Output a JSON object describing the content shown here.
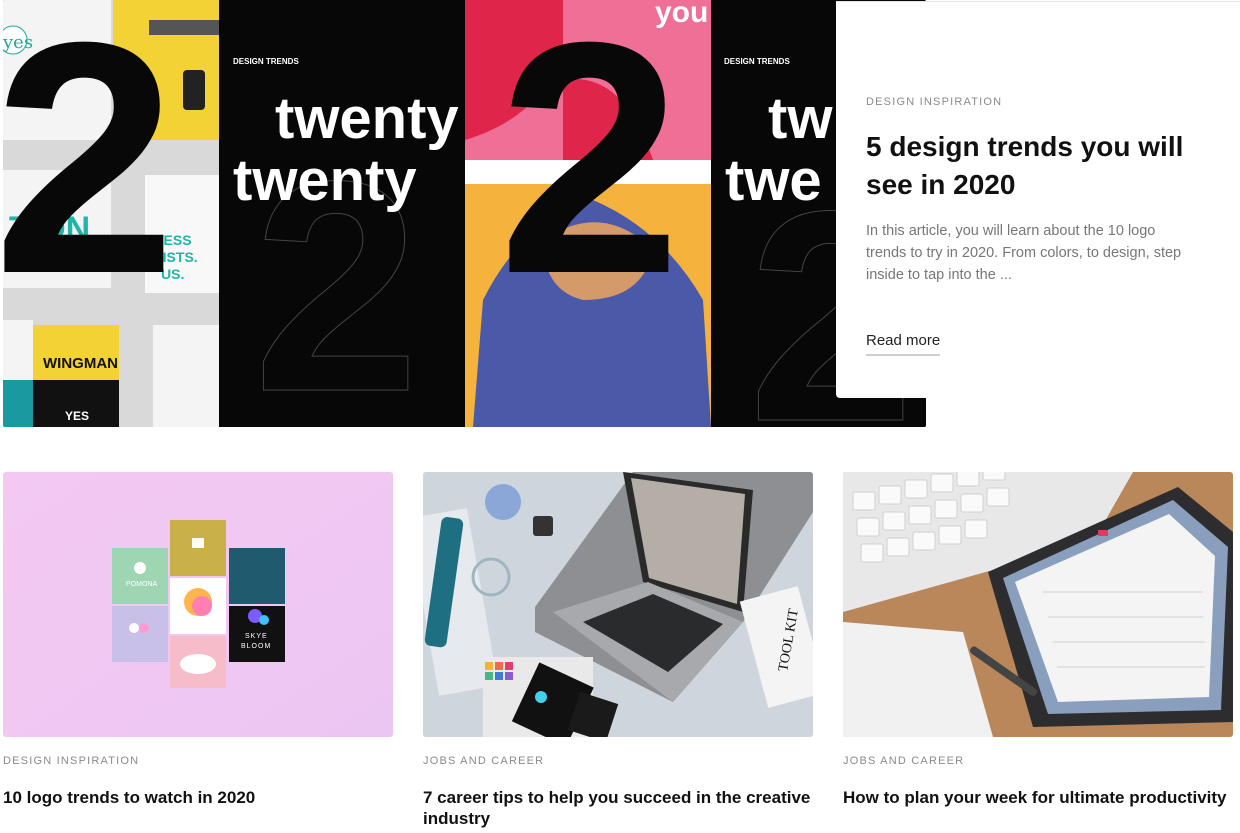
{
  "featured": {
    "image_text": {
      "numeral": "2",
      "trend_label": "DESIGN TRENDS",
      "word1": "twenty",
      "word2": "twenty",
      "top_text": "you",
      "side_word1": "tw",
      "side_word2": "twe",
      "book_yes": "yes",
      "book_wingman": "WINGMAN",
      "book_yes2": "YES",
      "book_line": "LESS MISTS. US."
    },
    "category": "DESIGN INSPIRATION",
    "title": "5 design trends you will see in 2020",
    "description": "In this article, you will learn about the 10 logo trends to try in 2020. From colors, to design, step inside to tap into the ...",
    "read_more": "Read more"
  },
  "articles": [
    {
      "category": "DESIGN INSPIRATION",
      "title": "10 logo trends to watch in 2020",
      "image_text": {
        "pomona": "POMONA",
        "skye": "SKYE",
        "bloom": "BLOOM"
      }
    },
    {
      "category": "JOBS AND CAREER",
      "title": "7 career tips to help you succeed in the creative industry",
      "image_text": {
        "toolkit": "TOOL KIT"
      }
    },
    {
      "category": "JOBS AND CAREER",
      "title": "How to plan your week for ultimate productivity",
      "image_text": {}
    }
  ],
  "colors": {
    "accent_pink": "#e8385a",
    "pink_bg": "#f0c4f0",
    "teal": "#1a6f78",
    "mustard": "#c8a83a"
  }
}
